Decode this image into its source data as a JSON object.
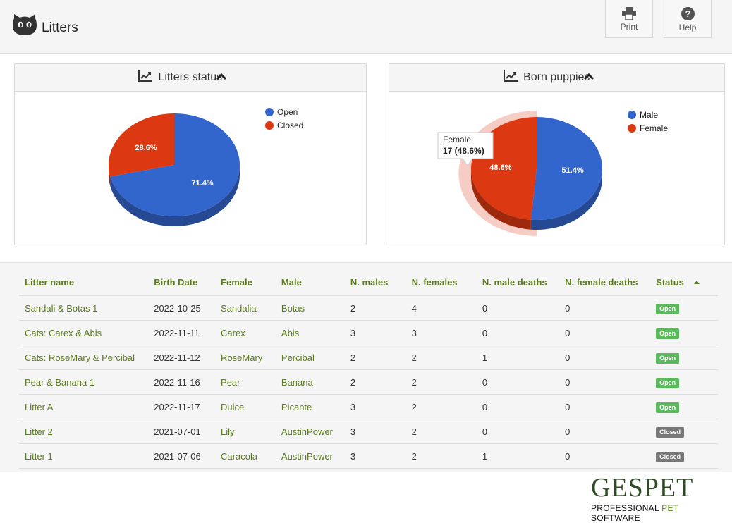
{
  "header": {
    "title": "Litters",
    "print_label": "Print",
    "help_label": "Help"
  },
  "panels": {
    "litters_status": {
      "title": "Litters status",
      "legend": [
        "Open",
        "Closed"
      ]
    },
    "born_puppies": {
      "title": "Born puppies",
      "legend": [
        "Male",
        "Female"
      ],
      "tooltip": {
        "label": "Female",
        "value": "17 (48.6%)"
      }
    }
  },
  "chart_data": [
    {
      "type": "pie",
      "title": "Litters status",
      "categories": [
        "Open",
        "Closed"
      ],
      "values": [
        71.4,
        28.6
      ],
      "labels": [
        "71.4%",
        "28.6%"
      ],
      "colors": [
        "#3366cc",
        "#dc3912"
      ],
      "legend": "top-right"
    },
    {
      "type": "pie",
      "title": "Born puppies",
      "categories": [
        "Male",
        "Female"
      ],
      "values": [
        51.4,
        48.6
      ],
      "labels": [
        "51.4%",
        "48.6%"
      ],
      "colors": [
        "#3366cc",
        "#dc3912"
      ],
      "legend": "top-right",
      "highlighted": "Female"
    }
  ],
  "table": {
    "columns": [
      "Litter name",
      "Birth Date",
      "Female",
      "Male",
      "N. males",
      "N. females",
      "N. male deaths",
      "N. female deaths",
      "Status"
    ],
    "sorted_by": "Status",
    "rows": [
      [
        "Sandali & Botas 1",
        "2022-10-25",
        "Sandalia",
        "Botas",
        "2",
        "4",
        "0",
        "0",
        "Open"
      ],
      [
        "Cats: Carex & Abis",
        "2022-11-11",
        "Carex",
        "Abis",
        "3",
        "3",
        "0",
        "0",
        "Open"
      ],
      [
        "Cats: RoseMary & Percibal",
        "2022-11-12",
        "RoseMary",
        "Percibal",
        "2",
        "2",
        "1",
        "0",
        "Open"
      ],
      [
        "Pear & Banana 1",
        "2022-11-16",
        "Pear",
        "Banana",
        "2",
        "2",
        "0",
        "0",
        "Open"
      ],
      [
        "Litter A",
        "2022-11-17",
        "Dulce",
        "Picante",
        "3",
        "2",
        "0",
        "0",
        "Open"
      ],
      [
        "Litter 2",
        "2021-07-01",
        "Lily",
        "AustinPower",
        "3",
        "2",
        "0",
        "0",
        "Closed"
      ],
      [
        "Litter 1",
        "2021-07-06",
        "Caracola",
        "AustinPower",
        "3",
        "2",
        "1",
        "0",
        "Closed"
      ]
    ]
  },
  "status_colors": {
    "Open": "#5cb85c",
    "Closed": "#777777"
  },
  "accent_color": "#5a7a1f",
  "brand": {
    "name": "GESPET",
    "tagline_a": "PROFESSIONAL ",
    "tagline_b": "PET",
    "tagline_c": " SOFTWARE"
  }
}
